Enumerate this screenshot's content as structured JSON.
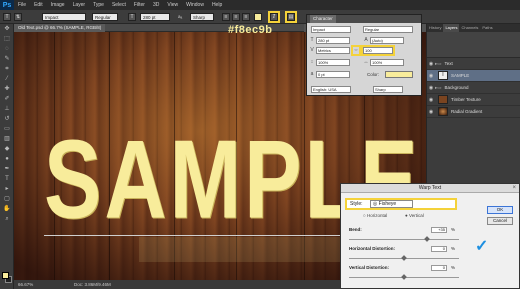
{
  "app": {
    "logo": "Ps"
  },
  "menu": [
    "File",
    "Edit",
    "Image",
    "Layer",
    "Type",
    "Select",
    "Filter",
    "3D",
    "View",
    "Window",
    "Help"
  ],
  "options": {
    "font_family": "Impact",
    "font_style": "Regular",
    "font_size": "280 pt",
    "antialias": "Sharp"
  },
  "hex_label": "#f8ec9b",
  "document": {
    "tab_title": "Old Text.psd @ 66.7% (SAMPLE, RGB/8)",
    "canvas_text": "SAMPLE",
    "zoom": "66.67%",
    "doc_size": "Doc: 3.86M/9.46M"
  },
  "character_panel": {
    "tab": "Character",
    "font_family": "Impact",
    "font_style": "Regular",
    "size": "280 pt",
    "leading": "(Auto)",
    "kerning": "Metrics",
    "tracking": "100",
    "vscale": "100%",
    "hscale": "100%",
    "baseline": "0 pt",
    "color_label": "Color:",
    "language": "English: USA",
    "aa": "Sharp"
  },
  "layers_panel": {
    "tabs": [
      "History",
      "Layers",
      "Channels",
      "Paths"
    ],
    "layers": [
      {
        "name": "Text",
        "group": true
      },
      {
        "name": "SAMPLE",
        "selected": true
      },
      {
        "name": "Background",
        "group": true
      },
      {
        "name": "Timber Texture"
      },
      {
        "name": "Radial Gradient"
      }
    ]
  },
  "warp_dialog": {
    "title": "Warp Text",
    "style_label": "Style:",
    "style_value": "Fisheye",
    "horizontal": "Horizontal",
    "vertical": "Vertical",
    "bend_label": "Bend:",
    "bend_value": "+35",
    "h_distortion_label": "Horizontal Distortion:",
    "h_distortion_value": "0",
    "v_distortion_label": "Vertical Distortion:",
    "v_distortion_value": "0",
    "pct": "%",
    "ok": "OK",
    "cancel": "Cancel"
  },
  "colors": {
    "text": "#f8ec9b",
    "highlight": "#f4d23a"
  }
}
